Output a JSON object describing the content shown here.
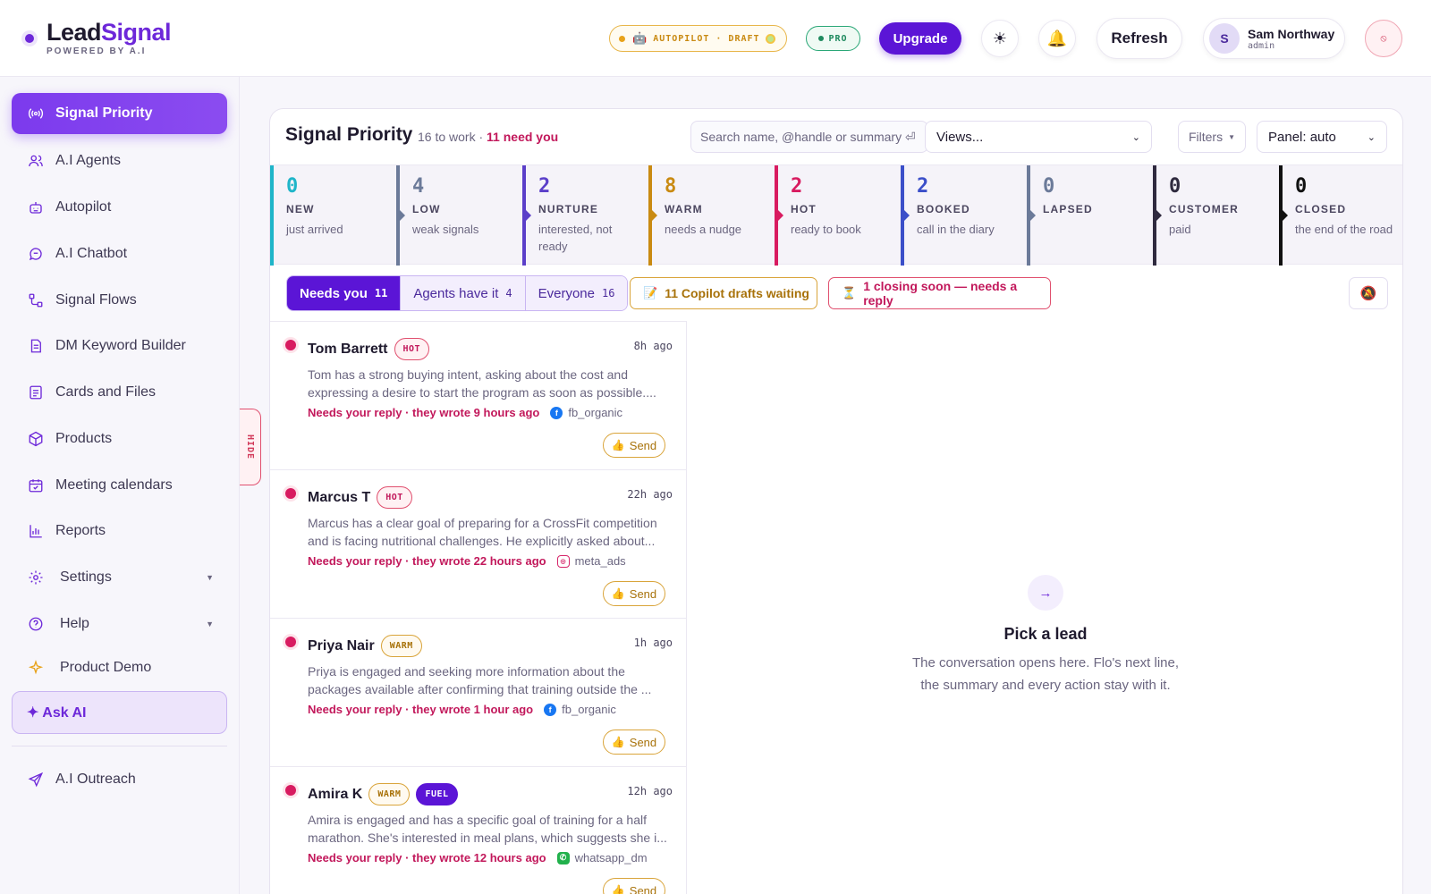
{
  "brand": {
    "name_a": "Lead",
    "name_b": "Signal",
    "tagline": "POWERED BY A.I"
  },
  "header": {
    "autopilot_label": "AUTOPILOT · DRAFT",
    "pro_label": "PRO",
    "upgrade_label": "Upgrade",
    "theme_icon": "sun-icon",
    "notify_icon": "bell-icon",
    "refresh_label": "Refresh",
    "user": {
      "initial": "S",
      "name": "Sam Northway",
      "role": "admin"
    },
    "power_icon": "power-icon"
  },
  "sidebar": {
    "items": [
      {
        "label": "Signal Priority",
        "icon": "signal-icon",
        "active": true
      },
      {
        "label": "A.I Agents",
        "icon": "users-icon"
      },
      {
        "label": "Autopilot",
        "icon": "robot-icon"
      },
      {
        "label": "A.I Chatbot",
        "icon": "chat-icon"
      },
      {
        "label": "Signal Flows",
        "icon": "flow-icon"
      },
      {
        "label": "DM Keyword Builder",
        "icon": "document-icon"
      },
      {
        "label": "Cards and Files",
        "icon": "file-icon"
      },
      {
        "label": "Products",
        "icon": "box-icon"
      },
      {
        "label": "Meeting calendars",
        "icon": "calendar-icon"
      },
      {
        "label": "Reports",
        "icon": "chart-icon"
      },
      {
        "label": "Settings",
        "icon": "gear-icon",
        "expandable": true
      },
      {
        "label": "Help",
        "icon": "help-icon",
        "expandable": true
      },
      {
        "label": "Product Demo",
        "icon": "sparkle-icon"
      }
    ],
    "ask_ai": "✦ Ask AI",
    "outreach": {
      "label": "A.I Outreach",
      "icon": "send-icon"
    },
    "hide_label": "HIDE"
  },
  "panel": {
    "title": "Signal Priority",
    "sub_count": "16 to work",
    "sub_sep": " · ",
    "sub_need": "11 need you",
    "search_placeholder": "Search name, @handle or summary ⏎",
    "views_label": "Views...",
    "filters_label": "Filters",
    "panel_select": "Panel: auto"
  },
  "stages": [
    {
      "count": "0",
      "name": "NEW",
      "desc": "just arrived",
      "color": "#1fb5c9"
    },
    {
      "count": "4",
      "name": "LOW",
      "desc": "weak signals",
      "color": "#6b7a99"
    },
    {
      "count": "2",
      "name": "NURTURE",
      "desc": "interested, not ready",
      "color": "#5b3fc9"
    },
    {
      "count": "8",
      "name": "WARM",
      "desc": "needs a nudge",
      "color": "#c98a12"
    },
    {
      "count": "2",
      "name": "HOT",
      "desc": "ready to book",
      "color": "#d81b60"
    },
    {
      "count": "2",
      "name": "BOOKED",
      "desc": "call in the diary",
      "color": "#3b4fc9"
    },
    {
      "count": "0",
      "name": "LAPSED",
      "desc": "",
      "color": "#6b7a99"
    },
    {
      "count": "0",
      "name": "CUSTOMER",
      "desc": "paid",
      "color": "#2f2a3f"
    },
    {
      "count": "0",
      "name": "CLOSED",
      "desc": "the end of the road",
      "color": "#111111"
    }
  ],
  "tabs": [
    {
      "label": "Needs you",
      "count": "11",
      "active": true
    },
    {
      "label": "Agents have it",
      "count": "4"
    },
    {
      "label": "Everyone",
      "count": "16"
    }
  ],
  "chips": {
    "drafts": "11 Copilot drafts waiting",
    "closing": "1 closing soon — needs a reply"
  },
  "leads": [
    {
      "name": "Tom Barrett",
      "badges": [
        "HOT"
      ],
      "time": "8h  ago",
      "summary": "Tom has a strong buying intent, asking about the cost and expressing a desire to start the program as soon as possible....",
      "reply": "Needs your reply · they wrote 9 hours ago",
      "source": "fb_organic",
      "source_icon": "facebook-icon",
      "send": "Send"
    },
    {
      "name": "Marcus T",
      "badges": [
        "HOT"
      ],
      "time": "22h  ago",
      "summary": "Marcus has a clear goal of preparing for a CrossFit competition and is facing nutritional challenges. He explicitly asked about...",
      "reply": "Needs your reply · they wrote 22 hours ago",
      "source": "meta_ads",
      "source_icon": "instagram-icon",
      "send": "Send"
    },
    {
      "name": "Priya Nair",
      "badges": [
        "WARM"
      ],
      "time": "1h  ago",
      "summary": "Priya is engaged and seeking more information about the packages available after confirming that training outside the ...",
      "reply": "Needs your reply · they wrote 1 hour ago",
      "source": "fb_organic",
      "source_icon": "facebook-icon",
      "send": "Send"
    },
    {
      "name": "Amira K",
      "badges": [
        "WARM",
        "FUEL"
      ],
      "time": "12h  ago",
      "summary": "Amira is engaged and has a specific goal of training for a half marathon. She's interested in meal plans, which suggests she i...",
      "reply": "Needs your reply · they wrote 12 hours ago",
      "source": "whatsapp_dm",
      "source_icon": "whatsapp-icon",
      "send": "Send"
    }
  ],
  "empty": {
    "title": "Pick a lead",
    "desc_line1": "The conversation opens here. Flo's next line,",
    "desc_line2": "the summary and every action stay with it."
  }
}
